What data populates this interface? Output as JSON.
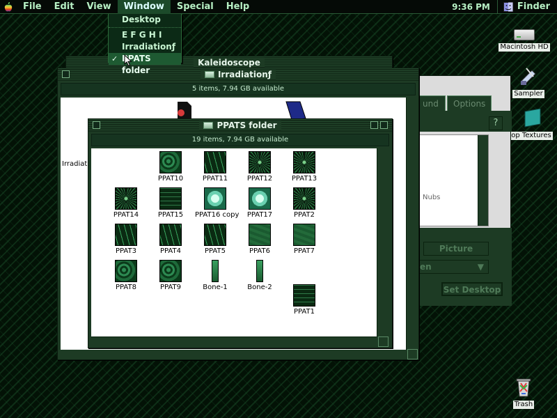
{
  "menubar": {
    "items": [
      "File",
      "Edit",
      "View",
      "Window",
      "Special",
      "Help"
    ],
    "active": "Window",
    "clock": "9:36 PM",
    "app_name": "Finder"
  },
  "window_menu": {
    "items": [
      {
        "label": "Desktop",
        "checked": false,
        "selected": false
      },
      {
        "label": "E F G H I",
        "checked": false,
        "selected": false
      },
      {
        "label": "Irradiationƒ",
        "checked": false,
        "selected": false
      },
      {
        "label": "PPATS folder",
        "checked": true,
        "selected": true
      }
    ]
  },
  "desktop_icons": {
    "hd": "Macintosh HD",
    "sampler": "Sampler",
    "textures": "op Textures",
    "trash": "Trash"
  },
  "kaleidoscope": {
    "title": "Kaleidoscope",
    "tab_sound": "und",
    "tab_options": "Options",
    "list_text": "Nubs",
    "picture_button": "Picture",
    "popup_value": "en",
    "set_desktop_button": "Set Desktop"
  },
  "irradiation": {
    "title": "Irradiationƒ",
    "info": "5 items, 7.94 GB available",
    "left_label": "Irradiat"
  },
  "ppats": {
    "title": "PPATS folder",
    "info": "19 items, 7.94 GB available",
    "files": [
      {
        "name": "PPAT10",
        "style": "swirl"
      },
      {
        "name": "PPAT11",
        "style": "wave"
      },
      {
        "name": "PPAT12",
        "style": "burst"
      },
      {
        "name": "PPAT13",
        "style": "burst"
      },
      {
        "name": "PPAT14",
        "style": "burst"
      },
      {
        "name": "PPAT15",
        "style": "grid"
      },
      {
        "name": "PPAT16 copy",
        "style": "light"
      },
      {
        "name": "PPAT17",
        "style": "light"
      },
      {
        "name": "PPAT2",
        "style": "burst"
      },
      {
        "name": "PPAT3",
        "style": "wave"
      },
      {
        "name": "PPAT4",
        "style": "wave"
      },
      {
        "name": "PPAT5",
        "style": "wave"
      },
      {
        "name": "PPAT6",
        "style": "solid"
      },
      {
        "name": "PPAT7",
        "style": "solid"
      },
      {
        "name": "PPAT8",
        "style": "swirl"
      },
      {
        "name": "PPAT9",
        "style": "swirl"
      },
      {
        "name": "Bone-1",
        "style": "bone"
      },
      {
        "name": "Bone-2",
        "style": "bone"
      },
      {
        "name": "PPAT1",
        "style": "grid"
      }
    ]
  },
  "colors": {
    "accent_green": "#1d3b24",
    "menu_text": "#b7f0c4",
    "highlight": "#1e5a32"
  }
}
